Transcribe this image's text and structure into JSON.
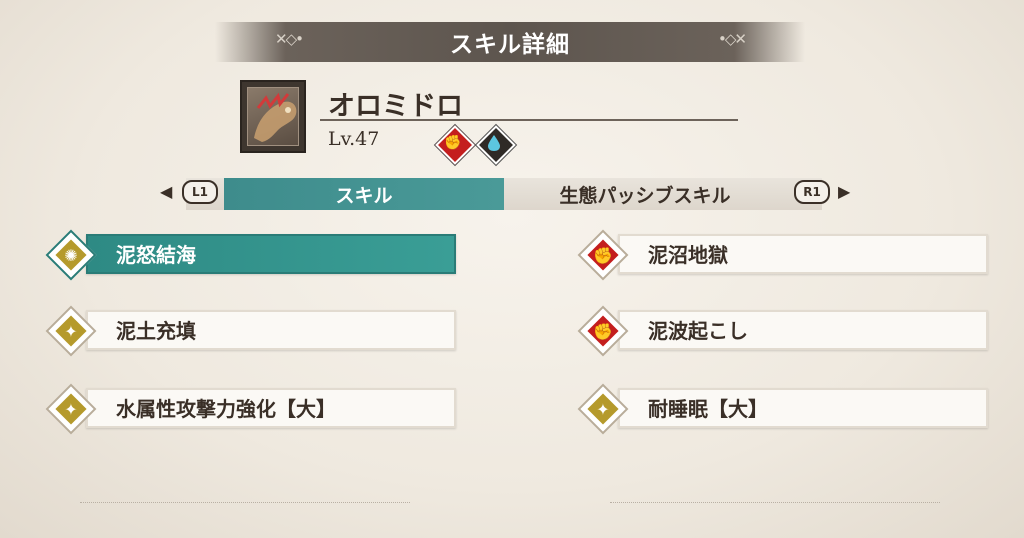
{
  "header": {
    "title": "スキル詳細"
  },
  "monster": {
    "name": "オロミドロ",
    "level": "Lv.47",
    "elements": [
      {
        "icon": "muscle-icon",
        "color": "#c41e1e"
      },
      {
        "icon": "water-drop-icon",
        "color": "#2f2a26"
      }
    ]
  },
  "tabs": {
    "prev_button": "L1",
    "next_button": "R1",
    "prev_arrow": "◀",
    "next_arrow": "▶",
    "items": [
      "スキル",
      "生態パッシブスキル"
    ],
    "active": "スキル"
  },
  "skills": {
    "left": [
      {
        "label": "泥怒結海",
        "icon": "sun-icon",
        "color": "#b59a2c",
        "selected": true
      },
      {
        "label": "泥土充填",
        "icon": "flex-icon",
        "color": "#b59a2c"
      },
      {
        "label": "水属性攻撃力強化【大】",
        "icon": "flex-icon",
        "color": "#b59a2c"
      }
    ],
    "right": [
      {
        "label": "泥沼地獄",
        "icon": "muscle-icon",
        "color": "#c41e1e"
      },
      {
        "label": "泥波起こし",
        "icon": "muscle-icon",
        "color": "#c41e1e"
      },
      {
        "label": "耐睡眠【大】",
        "icon": "flex-icon",
        "color": "#b59a2c"
      }
    ]
  },
  "ornaments": {
    "left": "✕◇•",
    "right": "•◇✕"
  }
}
